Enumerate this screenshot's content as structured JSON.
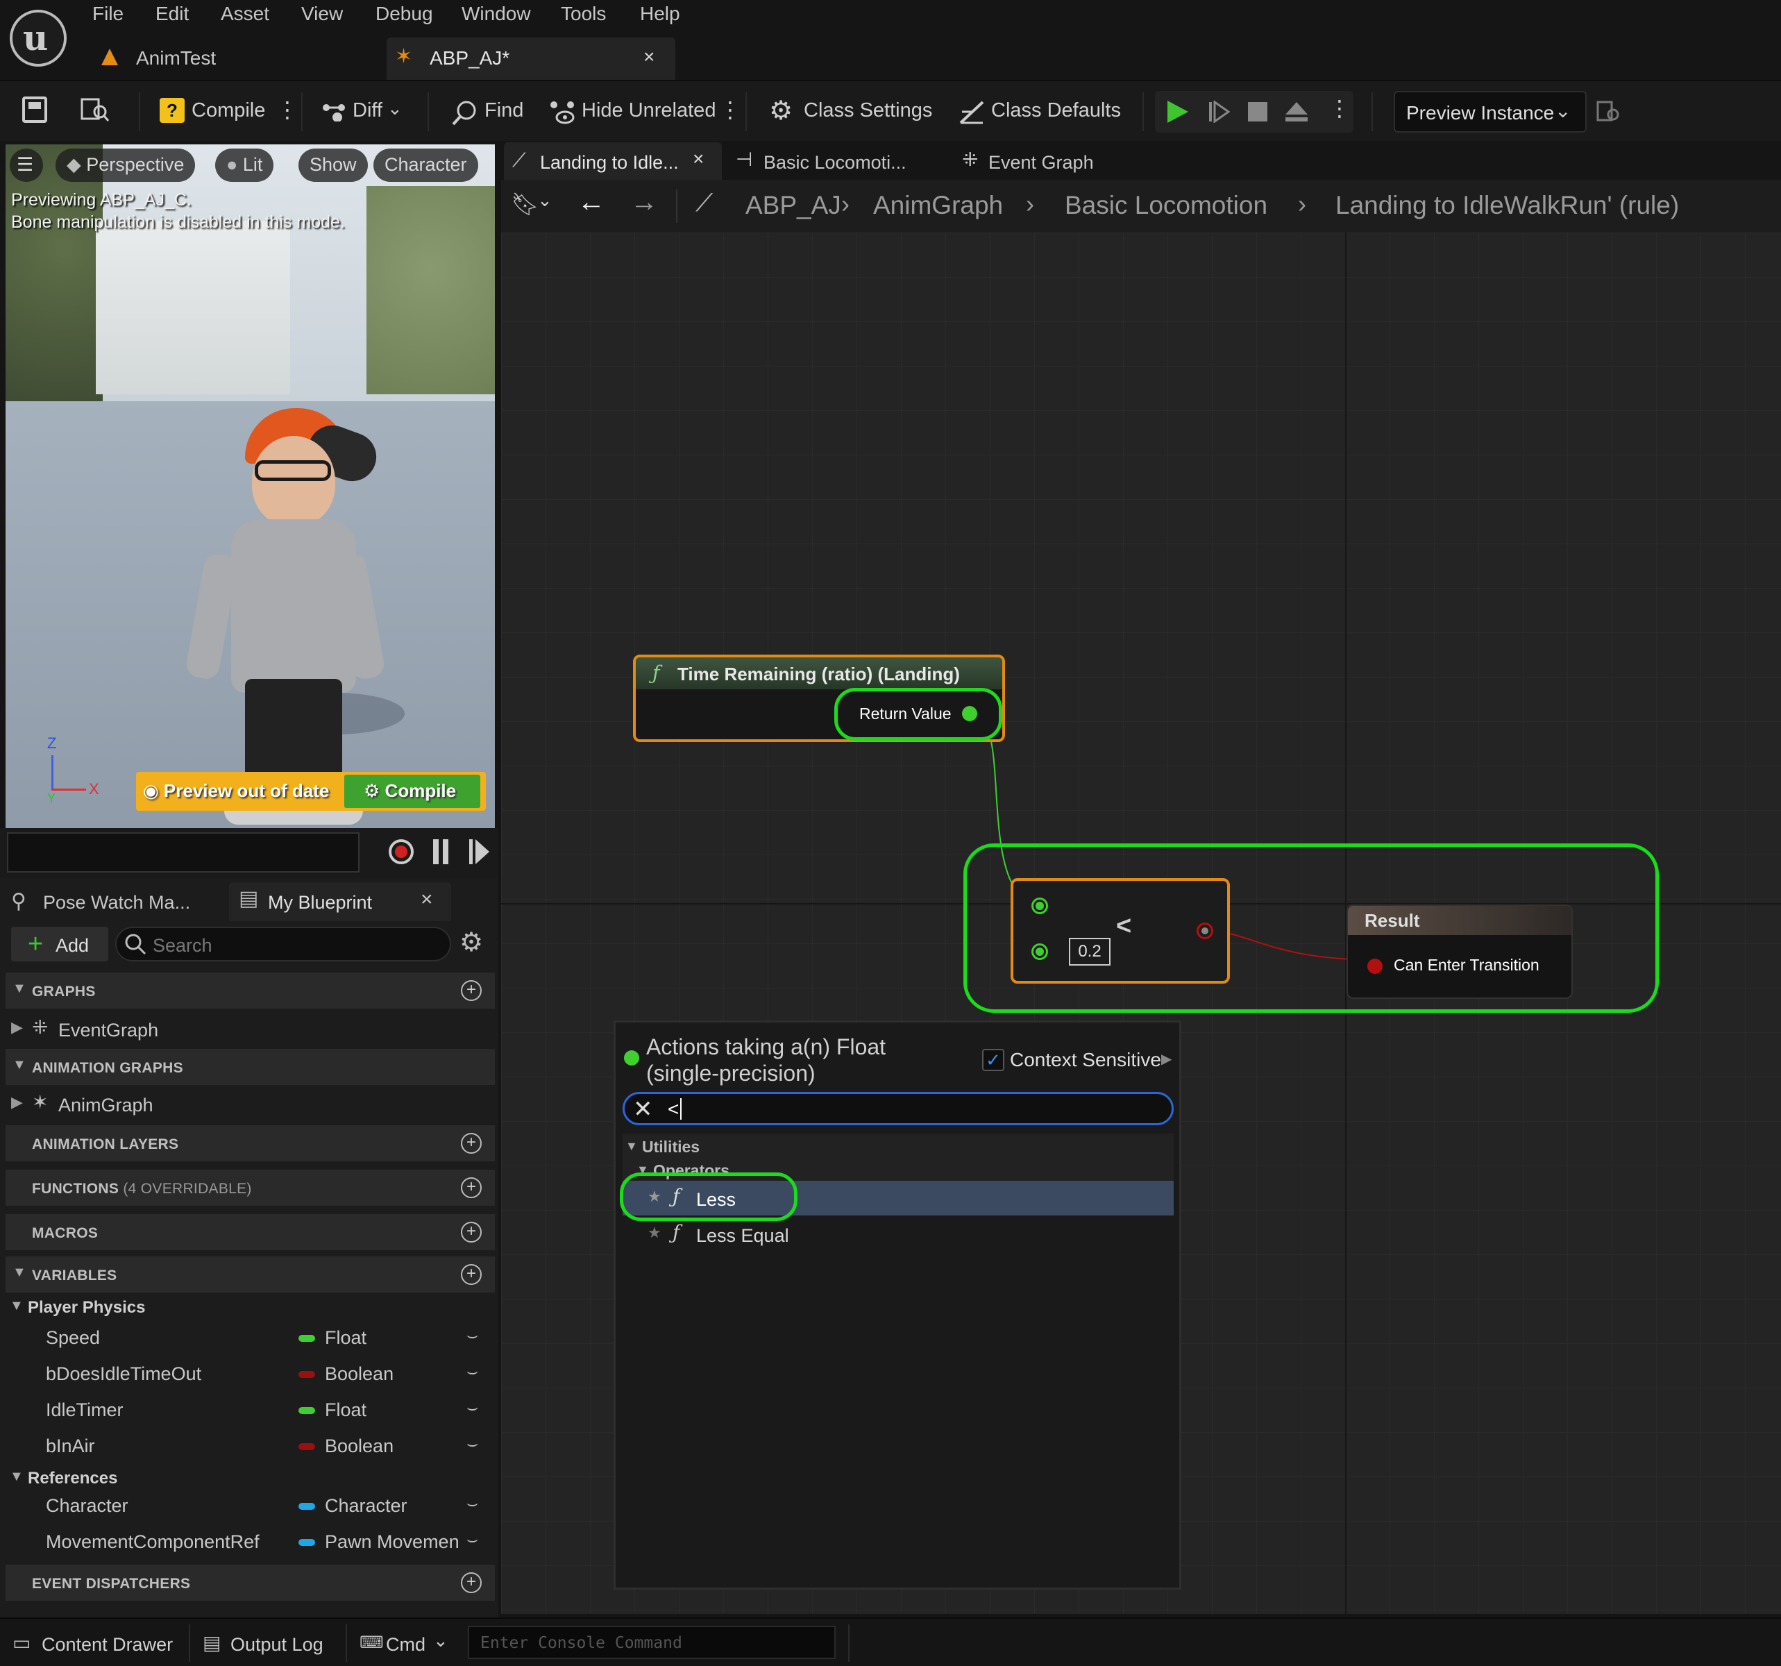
{
  "menu": [
    "File",
    "Edit",
    "Asset",
    "View",
    "Debug",
    "Window",
    "Tools",
    "Help"
  ],
  "tabs": [
    {
      "label": "AnimTest"
    },
    {
      "label": "ABP_AJ*"
    }
  ],
  "toolbar": {
    "compile": "Compile",
    "diff": "Diff",
    "find": "Find",
    "hide_unrelated": "Hide Unrelated",
    "class_settings": "Class Settings",
    "class_defaults": "Class Defaults",
    "preview_instance": "Preview Instance"
  },
  "viewport": {
    "perspective": "Perspective",
    "lit": "Lit",
    "show": "Show",
    "character": "Character",
    "info_line1": "Previewing ABP_AJ_C.",
    "info_line2": "Bone manipulation is disabled in this mode.",
    "axis_z": "Z",
    "axis_x": "X",
    "axis_y": "Y",
    "preview_out_of_date": "Preview out of date",
    "compile": "Compile"
  },
  "left_tabs": {
    "pose_watch": "Pose Watch Ma...",
    "my_blueprint": "My Blueprint",
    "add": "Add",
    "search_placeholder": "Search"
  },
  "sections": {
    "graphs": "GRAPHS",
    "event_graph": "EventGraph",
    "animation_graphs": "ANIMATION GRAPHS",
    "anim_graph": "AnimGraph",
    "animation_layers": "ANIMATION LAYERS",
    "functions": "FUNCTIONS",
    "functions_note": "(4 OVERRIDABLE)",
    "macros": "MACROS",
    "variables": "VARIABLES",
    "event_dispatchers": "EVENT DISPATCHERS"
  },
  "variables": {
    "player_physics": "Player Physics",
    "references": "References",
    "items": [
      {
        "name": "Speed",
        "type": "Float",
        "color": "#3fcf2f"
      },
      {
        "name": "bDoesIdleTimeOut",
        "type": "Boolean",
        "color": "#9a0f0f"
      },
      {
        "name": "IdleTimer",
        "type": "Float",
        "color": "#3fcf2f"
      },
      {
        "name": "bInAir",
        "type": "Boolean",
        "color": "#9a0f0f"
      },
      {
        "name": "Character",
        "type": "Character",
        "color": "#1ea7e6"
      },
      {
        "name": "MovementComponentRef",
        "type": "Pawn Movemen",
        "color": "#1ea7e6"
      }
    ]
  },
  "graph_tabs": {
    "landing": "Landing to Idle...",
    "basic_locomotion": "Basic Locomoti...",
    "event_graph": "Event Graph"
  },
  "breadcrumb": [
    "ABP_AJ",
    "AnimGraph",
    "Basic Locomotion",
    "Landing to IdleWalkRun' (rule)"
  ],
  "nodes": {
    "time_remaining_title": "Time Remaining (ratio) (Landing)",
    "return_value": "Return Value",
    "less_symbol": "<",
    "less_value": "0.2",
    "result_title": "Result",
    "can_enter_transition": "Can Enter Transition"
  },
  "popup": {
    "title": "Actions taking a(n) Float (single-precision)",
    "context_sensitive": "Context Sensitive",
    "search_value": "<",
    "utilities": "Utilities",
    "operators": "Operators",
    "items": [
      "Less",
      "Less Equal"
    ]
  },
  "bottom": {
    "content_drawer": "Content Drawer",
    "output_log": "Output Log",
    "cmd": "Cmd",
    "console_placeholder": "Enter Console Command"
  },
  "colors": {
    "highlight_green": "#1bdc1b",
    "float_pin": "#3fcf2f",
    "bool_pin": "#b40f0f",
    "node_orange": "#e38a12",
    "selected_row": "#3b4a60"
  }
}
